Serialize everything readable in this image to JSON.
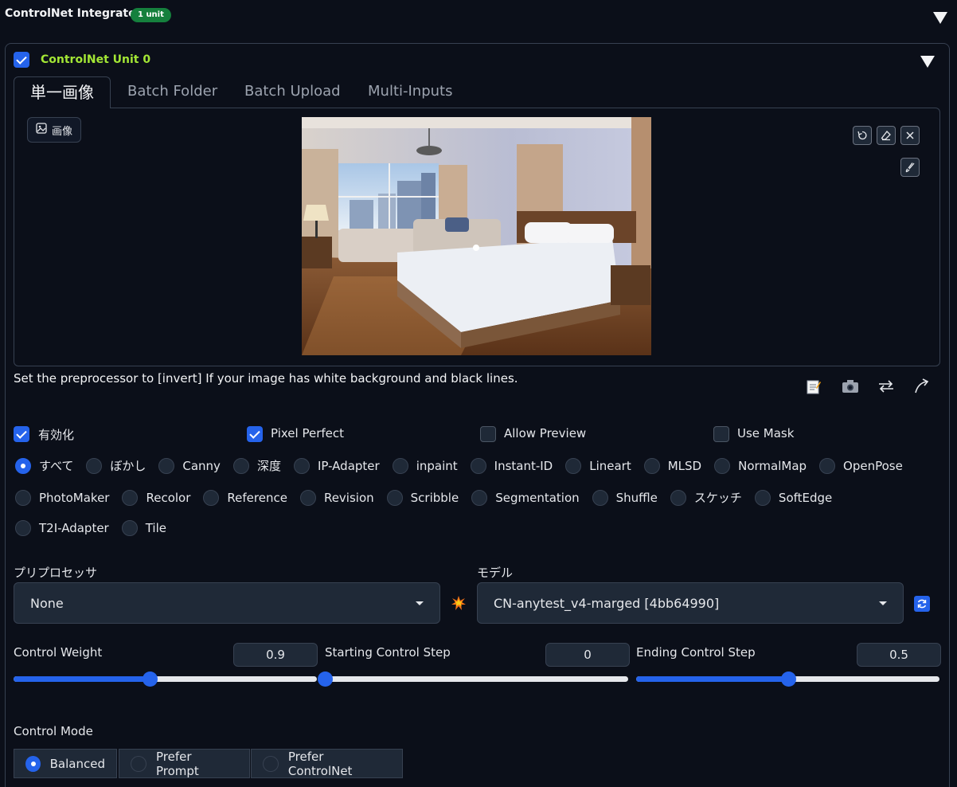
{
  "header": {
    "title": "ControlNet Integrated",
    "badge": "1 unit"
  },
  "unit": {
    "title": "ControlNet Unit 0",
    "enabled": true
  },
  "tabs": [
    "単一画像",
    "Batch Folder",
    "Batch Upload",
    "Multi-Inputs"
  ],
  "image_panel": {
    "label": "画像"
  },
  "hint": "Set the preprocessor to [invert] If your image has white background and black lines.",
  "options": {
    "enable": {
      "label": "有効化",
      "checked": true
    },
    "pixel_perfect": {
      "label": "Pixel Perfect",
      "checked": true
    },
    "allow_preview": {
      "label": "Allow Preview",
      "checked": false
    },
    "use_mask": {
      "label": "Use Mask",
      "checked": false
    }
  },
  "control_types": {
    "selected": "すべて",
    "row1": [
      "すべて",
      "ぼかし",
      "Canny",
      "深度",
      "IP-Adapter",
      "inpaint",
      "Instant-ID",
      "Lineart",
      "MLSD",
      "NormalMap",
      "OpenPose"
    ],
    "row2": [
      "PhotoMaker",
      "Recolor",
      "Reference",
      "Revision",
      "Scribble",
      "Segmentation",
      "Shuffle",
      "スケッチ",
      "SoftEdge"
    ],
    "row3": [
      "T2I-Adapter",
      "Tile"
    ]
  },
  "preprocessor": {
    "label": "プリプロセッサ",
    "value": "None"
  },
  "model": {
    "label": "モデル",
    "value": "CN-anytest_v4-marged [4bb64990]"
  },
  "sliders": {
    "control_weight": {
      "label": "Control Weight",
      "value": "0.9",
      "fraction": 0.45
    },
    "starting_step": {
      "label": "Starting Control Step",
      "value": "0",
      "fraction": 0.0
    },
    "ending_step": {
      "label": "Ending Control Step",
      "value": "0.5",
      "fraction": 0.5
    }
  },
  "control_mode": {
    "label": "Control Mode",
    "options": [
      "Balanced",
      "Prefer Prompt",
      "Prefer ControlNet"
    ],
    "selected": "Balanced"
  },
  "colors": {
    "accent": "#2563eb",
    "badge": "#15803d",
    "unit_title": "#a3e635",
    "background": "#0b0f19"
  }
}
